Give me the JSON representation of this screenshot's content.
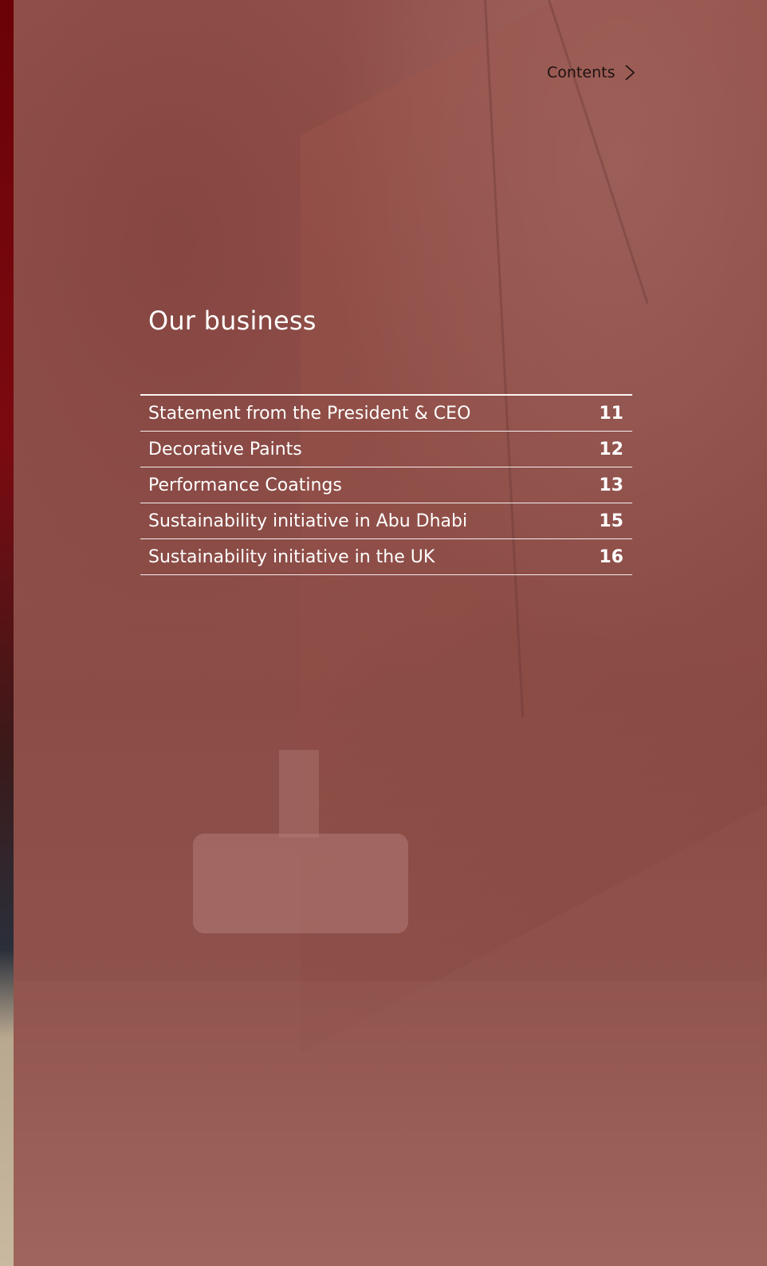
{
  "nav": {
    "contents_label": "Contents",
    "contents_icon": "chevron-right-icon"
  },
  "section": {
    "title": "Our business"
  },
  "toc": {
    "items": [
      {
        "label": "Statement from the President & CEO",
        "page": "11"
      },
      {
        "label": "Decorative Paints",
        "page": "12"
      },
      {
        "label": "Performance Coatings",
        "page": "13"
      },
      {
        "label": "Sustainability initiative in Abu Dhabi",
        "page": "15"
      },
      {
        "label": "Sustainability initiative in the UK",
        "page": "16"
      }
    ]
  },
  "colors": {
    "overlay": "#8d4f4a",
    "edge_strip": "#6a0208",
    "text": "#ffffff",
    "nav_text": "#1d1010"
  }
}
